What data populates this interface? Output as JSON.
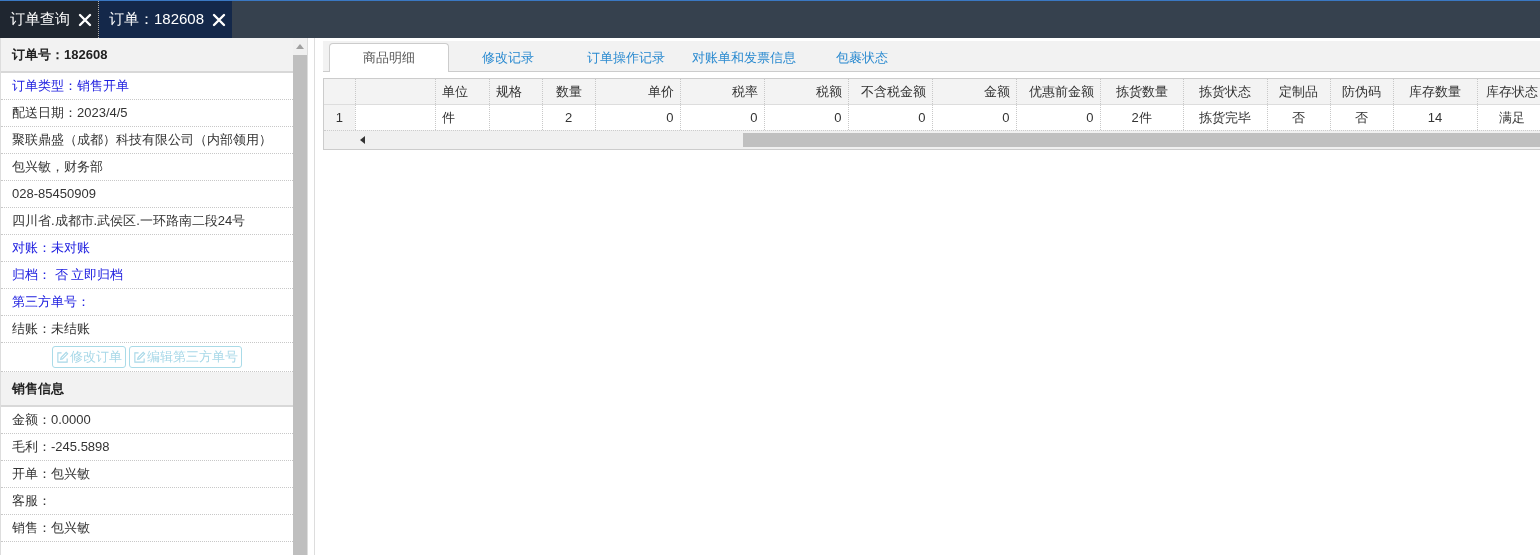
{
  "top_tabs": [
    {
      "label": "订单查询",
      "selected": false
    },
    {
      "label": "订单：182608",
      "selected": true
    }
  ],
  "order_panel": {
    "title": "订单号：182608",
    "rows": [
      {
        "text": "订单类型：销售开单",
        "kind": "link"
      },
      {
        "text": "配送日期：2023/4/5",
        "kind": "plain"
      },
      {
        "text": "聚联鼎盛（成都）科技有限公司（内部领用）",
        "kind": "plain"
      },
      {
        "text": "包兴敏，财务部",
        "kind": "plain"
      },
      {
        "text": "028-85450909",
        "kind": "plain"
      },
      {
        "text": "四川省.成都市.武侯区.一环路南二段24号",
        "kind": "plain"
      },
      {
        "text": "对账：未对账",
        "kind": "link"
      },
      {
        "text": "归档： 否 立即归档",
        "kind": "link"
      },
      {
        "text": "第三方单号：",
        "kind": "link"
      },
      {
        "text": "结账：未结账",
        "kind": "plain"
      }
    ],
    "buttons": [
      {
        "label": "修改订单",
        "disabled": true
      },
      {
        "label": "编辑第三方单号",
        "disabled": true
      }
    ]
  },
  "sales_panel": {
    "title": "销售信息",
    "rows": [
      {
        "text": "金额：0.0000"
      },
      {
        "text": "毛利：-245.5898"
      },
      {
        "text": "开单：包兴敏"
      },
      {
        "text": "客服："
      },
      {
        "text": "销售：包兴敏"
      }
    ]
  },
  "detail_tabs": [
    {
      "label": "商品明细",
      "selected": true
    },
    {
      "label": "修改记录",
      "selected": false
    },
    {
      "label": "订单操作记录",
      "selected": false
    },
    {
      "label": "对账单和发票信息",
      "selected": false
    },
    {
      "label": "包裹状态",
      "selected": false
    }
  ],
  "table": {
    "columns": [
      {
        "kind": "index"
      },
      {
        "kind": "left"
      },
      {
        "label": "单位",
        "kind": "left"
      },
      {
        "label": "规格",
        "kind": "left"
      },
      {
        "label": "数量",
        "kind": "center"
      },
      {
        "label": "单价",
        "kind": "number"
      },
      {
        "label": "税率",
        "kind": "number"
      },
      {
        "label": "税额",
        "kind": "number"
      },
      {
        "label": "不含税金额",
        "kind": "number"
      },
      {
        "label": "金额",
        "kind": "number"
      },
      {
        "label": "优惠前金额",
        "kind": "number"
      },
      {
        "label": "拣货数量",
        "kind": "center"
      },
      {
        "label": "拣货状态",
        "kind": "center"
      },
      {
        "label": "定制品",
        "kind": "center"
      },
      {
        "label": "防伪码",
        "kind": "center"
      },
      {
        "label": "库存数量",
        "kind": "center"
      },
      {
        "label": "库存状态",
        "kind": "center"
      }
    ],
    "rows": [
      [
        "1",
        null,
        "件",
        null,
        "2",
        "0",
        "0",
        "0",
        "0",
        "0",
        "0",
        "2件",
        "拣货完毕",
        "否",
        "否",
        "14",
        "满足"
      ]
    ]
  }
}
